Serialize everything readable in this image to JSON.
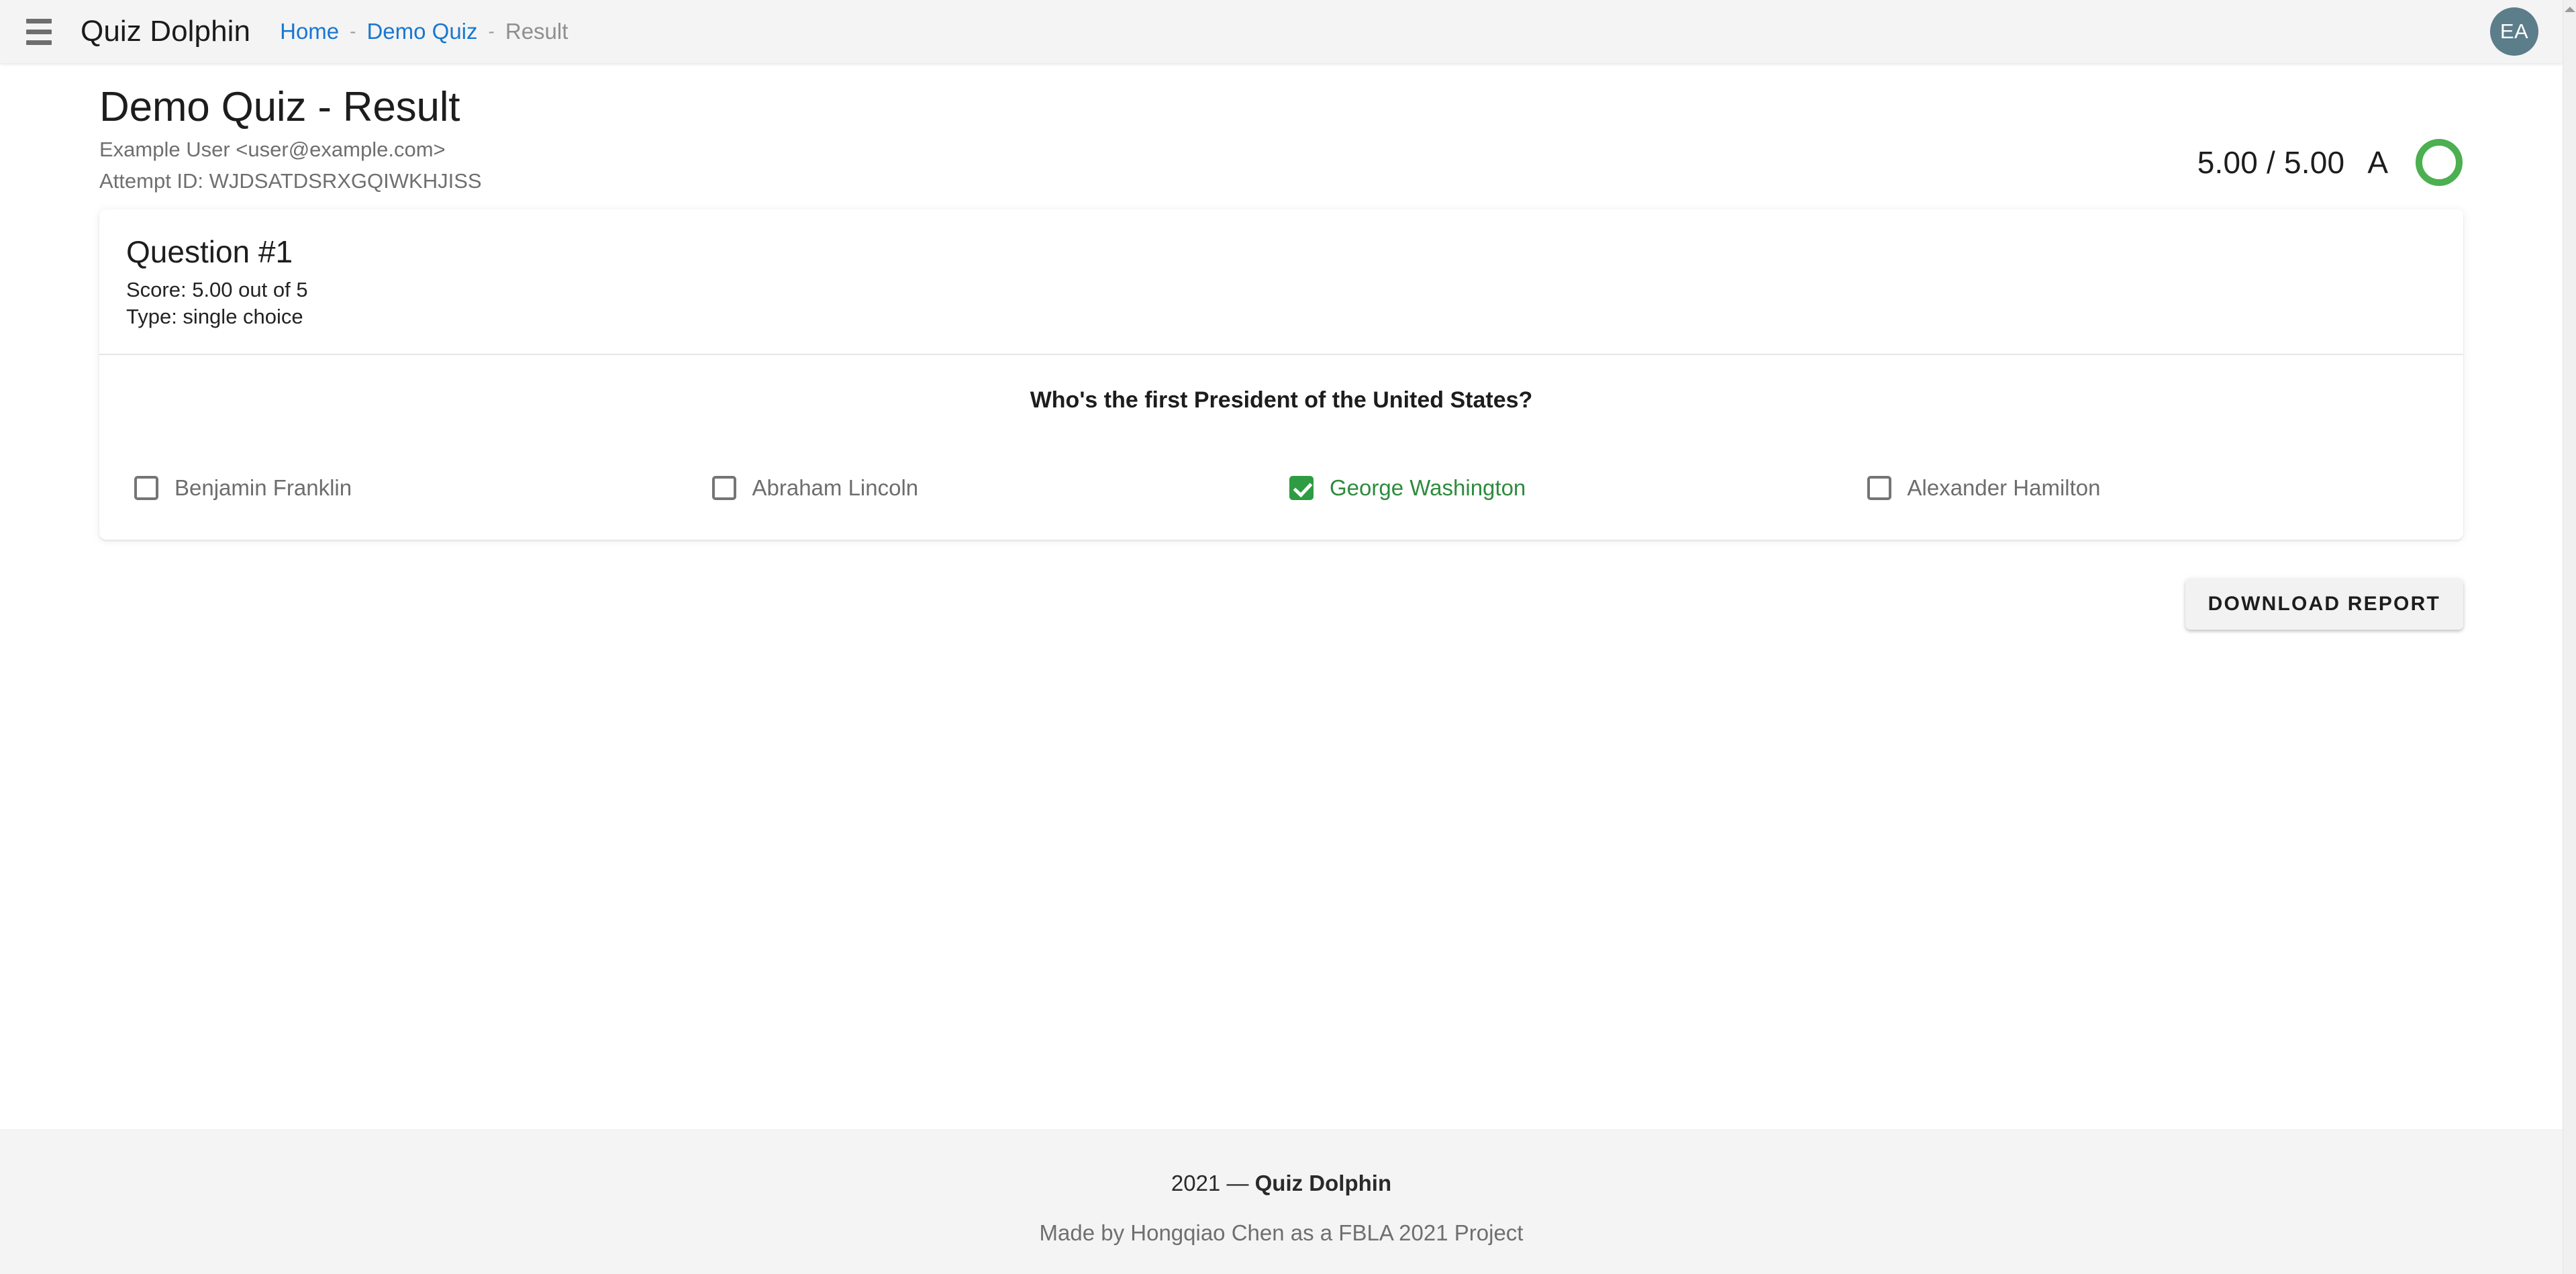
{
  "appbar": {
    "menu_icon": "hamburger-menu-icon",
    "brand": "Quiz Dolphin",
    "breadcrumbs": [
      {
        "label": "Home",
        "type": "link"
      },
      {
        "label": "-",
        "type": "separator"
      },
      {
        "label": "Demo Quiz",
        "type": "link"
      },
      {
        "label": "-",
        "type": "separator"
      },
      {
        "label": "Result",
        "type": "current"
      }
    ],
    "avatar_initials": "EA",
    "avatar_color": "#5c7d8a",
    "link_color": "#1877d2"
  },
  "header": {
    "title": "Demo Quiz - Result",
    "user": "Example User <user@example.com>",
    "attempt": "Attempt ID: WJDSATDSRXGQIWKHJISS",
    "score_text": "5.00 / 5.00",
    "grade": "A",
    "ring_percent": 100,
    "ring_color": "#4caf50"
  },
  "question": {
    "title": "Question #1",
    "score_line": "Score: 5.00 out of 5",
    "type_line": "Type: single choice",
    "prompt": "Who's the first President of the United States?",
    "options": [
      {
        "label": "Benjamin Franklin",
        "selected": false
      },
      {
        "label": "Abraham Lincoln",
        "selected": false
      },
      {
        "label": "George Washington",
        "selected": true
      },
      {
        "label": "Alexander Hamilton",
        "selected": false
      }
    ],
    "selected_color": "#2e8b3d",
    "unselected_color": "#6d6d6d"
  },
  "actions": {
    "download_label": "DOWNLOAD REPORT"
  },
  "footer": {
    "year": "2021",
    "dash": "—",
    "brand": "Quiz Dolphin",
    "credit": "Made by Hongqiao Chen as a FBLA 2021 Project"
  }
}
